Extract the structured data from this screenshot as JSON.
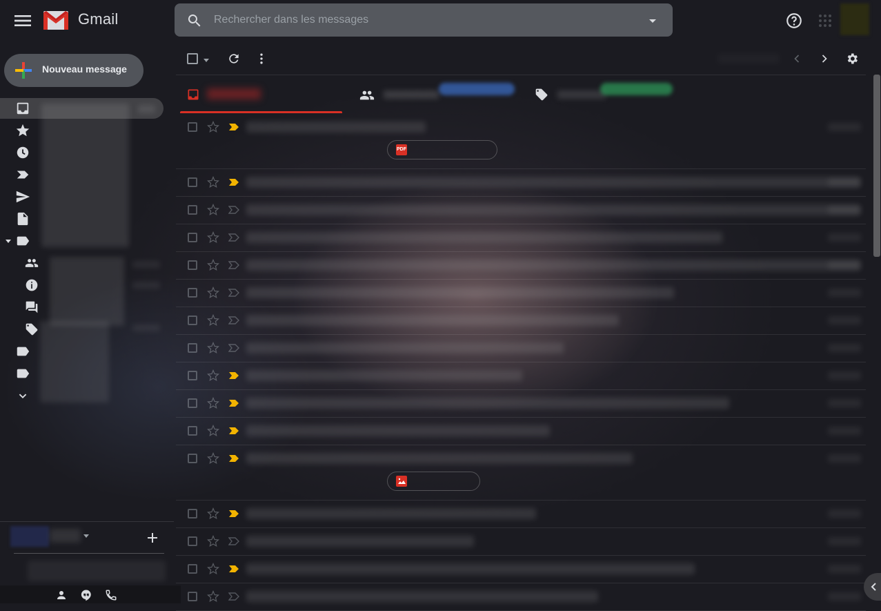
{
  "header": {
    "app_name": "Gmail",
    "search_placeholder": "Rechercher dans les messages"
  },
  "compose": {
    "label": "Nouveau message"
  },
  "attachments": [
    {
      "type": "pdf",
      "badge": "PDF"
    },
    {
      "type": "image",
      "badge": ""
    }
  ],
  "colors": {
    "gmail_red": "#d93025",
    "importance_marker": "#f2b300",
    "primary_tab_underline": "#d93025",
    "social_tab_accent": "#3c6fc9",
    "promotions_tab_accent": "#2e9e5b"
  },
  "icons": {
    "sidebar": [
      "inbox-icon",
      "star-icon",
      "snoozed-icon",
      "important-icon",
      "sent-icon",
      "drafts-icon",
      "categories-icon"
    ],
    "categories": [
      "social-icon",
      "updates-icon",
      "forums-icon",
      "promotions-icon"
    ],
    "footer": [
      "contacts-icon",
      "hangouts-icon",
      "phone-icon"
    ]
  }
}
